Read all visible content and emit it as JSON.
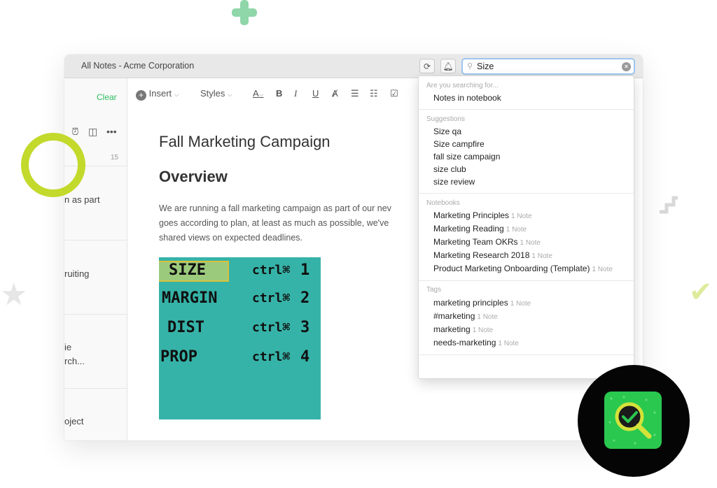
{
  "window": {
    "title": "All Notes - Acme Corporation"
  },
  "toolbar": {
    "sync_icon": "sync-icon",
    "bell_icon": "bell-icon",
    "insert_label": "Insert",
    "styles_label": "Styles",
    "icons": [
      "font-color-icon",
      "bold-icon",
      "italic-icon",
      "underline-icon",
      "highlight-icon",
      "bullet-list-icon",
      "numbered-list-icon",
      "checkbox-icon"
    ]
  },
  "search": {
    "value": "Size "
  },
  "note_list": {
    "clear_label": "Clear",
    "count": "15",
    "snippets": [
      "n as part",
      "ruiting",
      "ie",
      "rch...",
      "oject"
    ]
  },
  "note": {
    "title": "Fall Marketing Campaign",
    "heading": "Overview",
    "paragraph": [
      "We are running a fall marketing campaign as part of our nev",
      "goes according to plan, at least as much as possible, we've",
      "shared views on expected deadlines."
    ],
    "handwriting": [
      {
        "word": "SIZE",
        "shortcut": "1"
      },
      {
        "word": "MARGIN",
        "shortcut": "2"
      },
      {
        "word": "DIST",
        "shortcut": "3"
      },
      {
        "word": "PROP",
        "shortcut": "4"
      }
    ],
    "handwriting_prefix": "ctrl⌘"
  },
  "dropdown": {
    "searching_header": "Are you searching for...",
    "searching_item": "Notes in notebook",
    "suggestions_header": "Suggestions",
    "suggestions": [
      "Size qa",
      "Size campfire",
      "fall size campaign",
      "size club",
      "size review"
    ],
    "notebooks_header": "Notebooks",
    "notebooks": [
      {
        "name": "Marketing Principles",
        "count": "1 Note"
      },
      {
        "name": "Marketing Reading",
        "count": "1 Note"
      },
      {
        "name": "Marketing Team OKRs",
        "count": "1 Note"
      },
      {
        "name": "Marketing Research 2018",
        "count": "1 Note"
      },
      {
        "name": "Product Marketing Onboarding (Template)",
        "count": "1 Note"
      }
    ],
    "tags_header": "Tags",
    "tags": [
      {
        "name": "marketing principles",
        "count": "1 Note"
      },
      {
        "name": "#marketing",
        "count": "1 Note"
      },
      {
        "name": "marketing",
        "count": "1 Note"
      },
      {
        "name": "needs-marketing",
        "count": "1 Note"
      }
    ]
  },
  "colors": {
    "accent_green": "#2dbe60",
    "ring_lime": "#c3d92b",
    "sticky_teal": "#36b3a8",
    "badge_green": "#2ac84f"
  }
}
